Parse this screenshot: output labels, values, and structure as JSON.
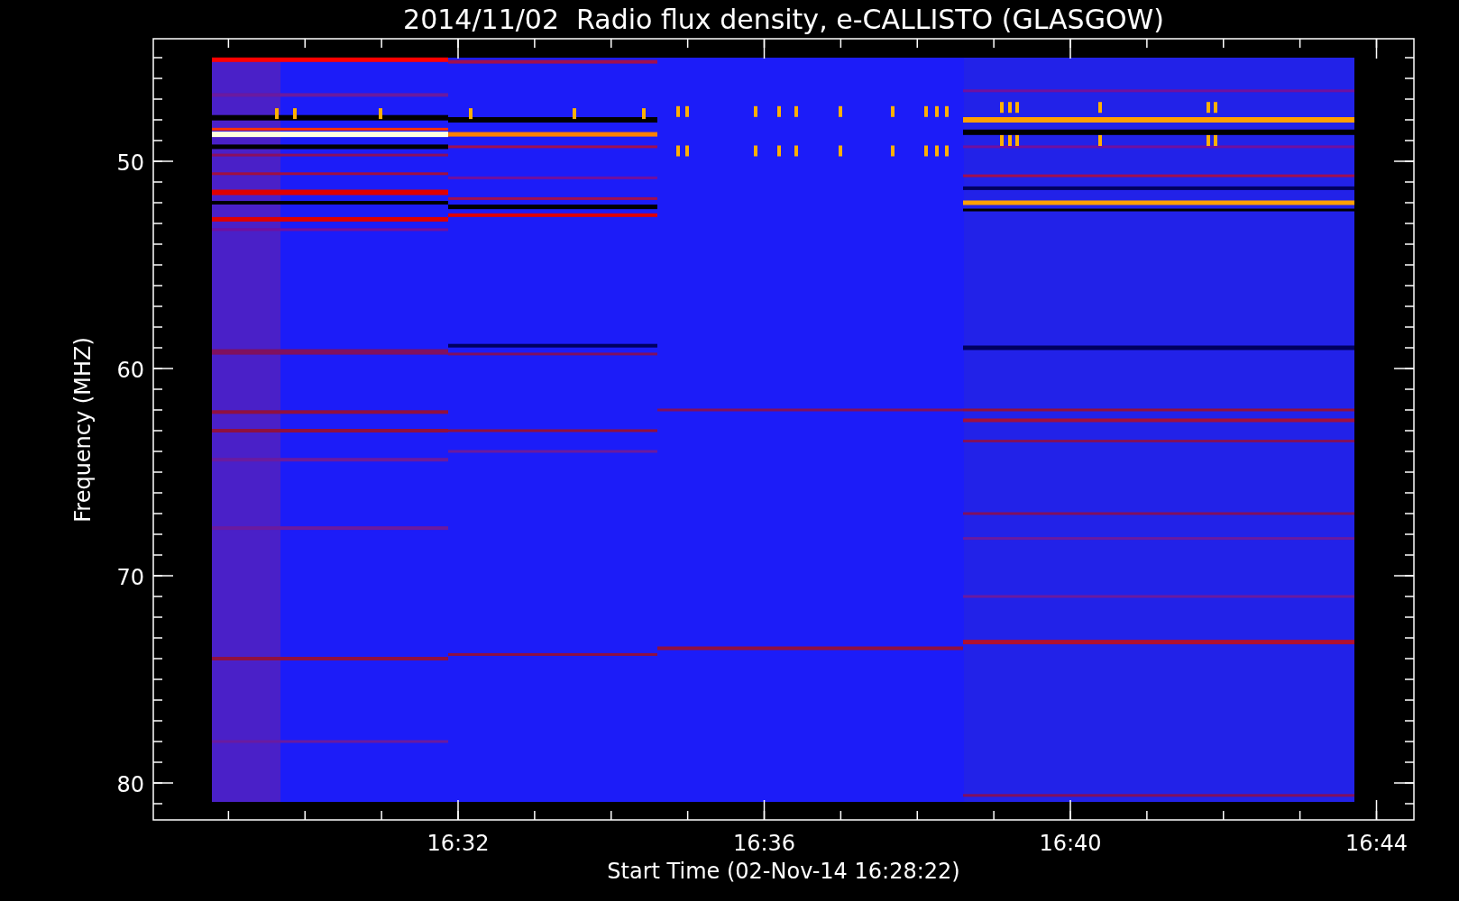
{
  "title": "2014/11/02  Radio flux density, e-CALLISTO (GLASGOW)",
  "y_axis": {
    "label": "Frequency (MHZ)",
    "ticks": [
      "50",
      "60",
      "70",
      "80"
    ]
  },
  "x_axis": {
    "label": "Start Time (02-Nov-14 16:28:22)",
    "ticks": [
      "16:32",
      "16:36",
      "16:40",
      "16:44"
    ]
  }
}
